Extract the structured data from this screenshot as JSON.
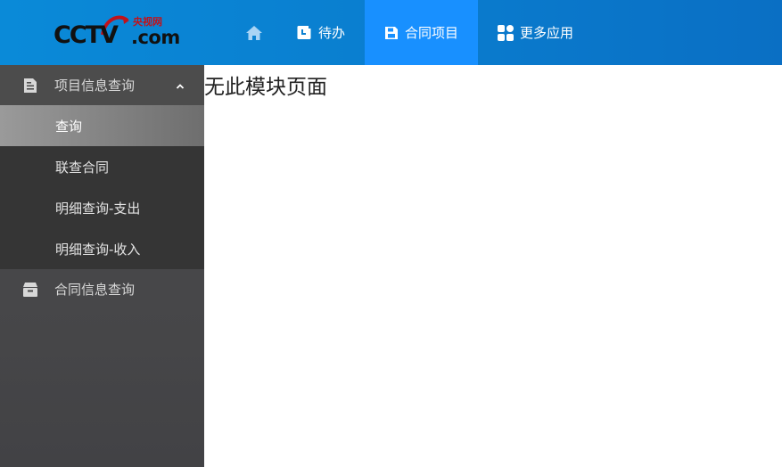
{
  "logo": {
    "brand": "CCTV",
    "domain": ".com",
    "cn_text": "央视网"
  },
  "nav": {
    "home_icon": "home-icon",
    "items": [
      {
        "label": "待办",
        "icon": "todo-icon"
      },
      {
        "label": "合同项目",
        "icon": "save-icon",
        "active": true
      },
      {
        "label": "更多应用",
        "icon": "apps-icon"
      }
    ]
  },
  "sidebar": {
    "groups": [
      {
        "label": "项目信息查询",
        "icon": "document-icon",
        "expanded": true,
        "items": [
          {
            "label": "查询",
            "active": true
          },
          {
            "label": "联查合同"
          },
          {
            "label": "明细查询-支出"
          },
          {
            "label": "明细查询-收入"
          }
        ]
      },
      {
        "label": "合同信息查询",
        "icon": "archive-icon",
        "expanded": false
      }
    ]
  },
  "main": {
    "message": "无此模块页面"
  },
  "colors": {
    "topbar": "#0a7fd0",
    "nav_active": "#1890ff",
    "sidebar": "#474747",
    "submenu": "#353535",
    "brand_red": "#c0121b"
  }
}
